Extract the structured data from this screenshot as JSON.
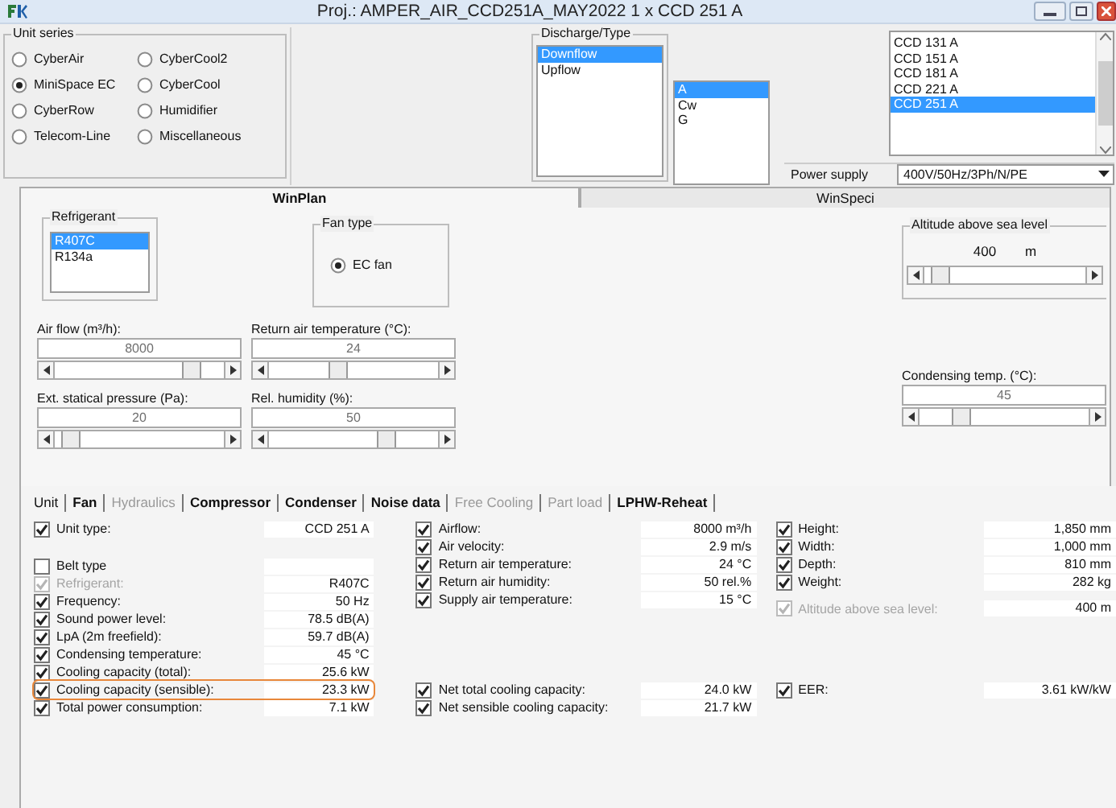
{
  "window": {
    "title": "Proj.: AMPER_AIR_CCD251A_MAY2022 1 x CCD 251 A"
  },
  "unit_series": {
    "label": "Unit series",
    "options": [
      {
        "label": "CyberAir",
        "selected": false
      },
      {
        "label": "CyberCool2",
        "selected": false
      },
      {
        "label": "MiniSpace EC",
        "selected": true
      },
      {
        "label": "CyberCool",
        "selected": false
      },
      {
        "label": "CyberRow",
        "selected": false
      },
      {
        "label": "Humidifier",
        "selected": false
      },
      {
        "label": "Telecom-Line",
        "selected": false
      },
      {
        "label": "Miscellaneous",
        "selected": false
      }
    ]
  },
  "discharge": {
    "label": "Discharge/Type",
    "items": [
      {
        "label": "Downflow",
        "selected": true
      },
      {
        "label": "Upflow",
        "selected": false
      }
    ]
  },
  "type_list": {
    "items": [
      {
        "label": "A",
        "selected": true
      },
      {
        "label": "Cw",
        "selected": false
      },
      {
        "label": "G",
        "selected": false
      }
    ]
  },
  "model_list": {
    "items": [
      {
        "label": "CCD 131 A",
        "selected": false
      },
      {
        "label": "CCD 151 A",
        "selected": false
      },
      {
        "label": "CCD 181 A",
        "selected": false
      },
      {
        "label": "CCD 221 A",
        "selected": false
      },
      {
        "label": "CCD 251 A",
        "selected": true
      }
    ]
  },
  "power_supply": {
    "label": "Power supply",
    "value": "400V/50Hz/3Ph/N/PE"
  },
  "tabs": [
    {
      "label": "WinPlan",
      "selected": true
    },
    {
      "label": "WinSpeci",
      "selected": false
    }
  ],
  "refrigerant": {
    "label": "Refrigerant",
    "items": [
      {
        "label": "R407C",
        "selected": true
      },
      {
        "label": "R134a",
        "selected": false
      }
    ]
  },
  "fan_type": {
    "label": "Fan type",
    "options": [
      {
        "label": "EC fan",
        "selected": true
      }
    ]
  },
  "sliders": [
    {
      "label": "Air flow (m³/h):",
      "value": "8000",
      "level": 0.85
    },
    {
      "label": "Return air temperature (°C):",
      "value": "24",
      "level": 0.4
    },
    {
      "label": "Ext. statical pressure (Pa):",
      "value": "20",
      "level": 0.04
    },
    {
      "label": "Rel. humidity (%):",
      "value": "50",
      "level": 0.72
    }
  ],
  "altitude": {
    "label": "Altitude above sea level",
    "value": "400",
    "unit": "m",
    "level": 0.05
  },
  "condensing_temp": {
    "label": "Condensing temp. (°C):",
    "value": "45",
    "level": 0.22
  },
  "result_tabs": [
    {
      "label": "Unit",
      "selected": true,
      "disabled": false
    },
    {
      "label": "Fan",
      "selected": false,
      "disabled": false
    },
    {
      "label": "Hydraulics",
      "selected": false,
      "disabled": true
    },
    {
      "label": "Compressor",
      "selected": false,
      "disabled": false
    },
    {
      "label": "Condenser",
      "selected": false,
      "disabled": false
    },
    {
      "label": "Noise data",
      "selected": false,
      "disabled": false
    },
    {
      "label": "Free Cooling",
      "selected": false,
      "disabled": true
    },
    {
      "label": "Part load",
      "selected": false,
      "disabled": true
    },
    {
      "label": "LPHW-Reheat",
      "selected": false,
      "disabled": false
    }
  ],
  "results": {
    "columns": [
      {
        "groups": [
          {
            "rows": [
              {
                "label": "Unit type:",
                "checked": true,
                "disabled": false,
                "highlighted": false,
                "value": "CCD 251 A"
              }
            ]
          },
          {
            "rows": [
              {
                "label": "Belt type",
                "checked": false,
                "disabled": false,
                "highlighted": false
              },
              {
                "label": "Refrigerant:",
                "checked": true,
                "disabled": true,
                "highlighted": false,
                "value": "R407C"
              },
              {
                "label": "Frequency:",
                "checked": true,
                "disabled": false,
                "highlighted": false,
                "value": "50 Hz"
              },
              {
                "label": "Sound power level:",
                "checked": true,
                "disabled": false,
                "highlighted": false,
                "value": "78.5 dB(A)"
              },
              {
                "label": "LpA (2m freefield):",
                "checked": true,
                "disabled": false,
                "highlighted": false,
                "value": "59.7 dB(A)"
              },
              {
                "label": "Condensing temperature:",
                "checked": true,
                "disabled": false,
                "highlighted": false,
                "value": "45 °C"
              },
              {
                "label": "Cooling capacity (total):",
                "checked": true,
                "disabled": false,
                "highlighted": false,
                "value": "25.6 kW"
              },
              {
                "label": "Cooling capacity (sensible):",
                "checked": true,
                "disabled": false,
                "highlighted": true,
                "value": "23.3 kW"
              },
              {
                "label": "Total power consumption:",
                "checked": true,
                "disabled": false,
                "highlighted": false,
                "value": "7.1 kW"
              }
            ]
          }
        ]
      },
      {
        "groups": [
          {
            "rows": [
              {
                "label": "Airflow:",
                "checked": true,
                "disabled": false,
                "highlighted": false,
                "value": "8000 m³/h"
              },
              {
                "label": "Air velocity:",
                "checked": true,
                "disabled": false,
                "highlighted": false,
                "value": "2.9 m/s"
              },
              {
                "label": "Return air temperature:",
                "checked": true,
                "disabled": false,
                "highlighted": false,
                "value": "24 °C"
              },
              {
                "label": "Return air humidity:",
                "checked": true,
                "disabled": false,
                "highlighted": false,
                "value": "50 rel.%"
              },
              {
                "label": "Supply air temperature:",
                "checked": true,
                "disabled": false,
                "highlighted": false,
                "value": "15 °C"
              }
            ]
          },
          {
            "rows": [
              {
                "label": "Net total cooling capacity:",
                "checked": true,
                "disabled": false,
                "highlighted": false,
                "value": "24.0 kW"
              },
              {
                "label": "Net sensible cooling capacity:",
                "checked": true,
                "disabled": false,
                "highlighted": false,
                "value": "21.7 kW"
              }
            ]
          }
        ]
      },
      {
        "groups": [
          {
            "rows": [
              {
                "label": "Height:",
                "checked": true,
                "disabled": false,
                "highlighted": false,
                "value": "1,850 mm"
              },
              {
                "label": "Width:",
                "checked": true,
                "disabled": false,
                "highlighted": false,
                "value": "1,000 mm"
              },
              {
                "label": "Depth:",
                "checked": true,
                "disabled": false,
                "highlighted": false,
                "value": "810 mm"
              },
              {
                "label": "Weight:",
                "checked": true,
                "disabled": false,
                "highlighted": false,
                "value": "282 kg"
              },
              {
                "label": "Altitude above sea level:",
                "checked": true,
                "disabled": true,
                "highlighted": false,
                "value": "400 m"
              }
            ]
          },
          {
            "rows": [
              {
                "label": "EER:",
                "checked": true,
                "disabled": false,
                "highlighted": false,
                "value": "3.61 kW/kW"
              }
            ]
          }
        ]
      }
    ]
  }
}
